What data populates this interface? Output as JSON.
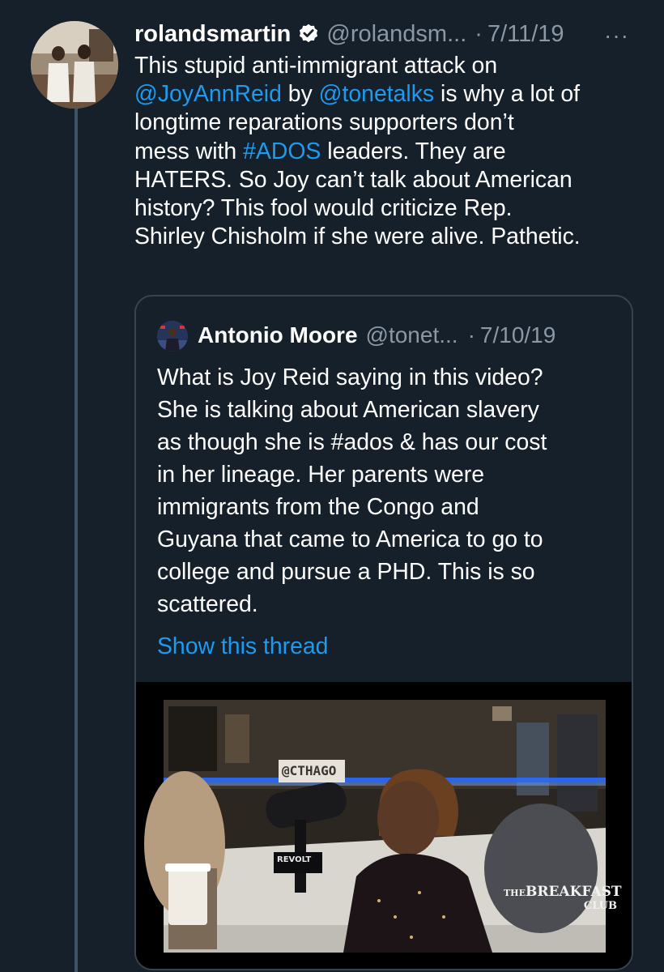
{
  "tweet": {
    "display_name": "rolandsmartin",
    "handle": "@rolandsm...",
    "separator": "·",
    "date": "7/11/19",
    "more_label": "···",
    "verified_icon": "verified-badge-icon",
    "text": {
      "line1": "This stupid anti-immigrant attack on",
      "mention1": "@JoyAnnReid",
      "by": " by ",
      "mention2": "@tonetalks",
      "after_mention2": " is why a lot of",
      "line3": "longtime reparations supporters don’t",
      "line4a": "mess with ",
      "hashtag": "#ADOS",
      "line4b": " leaders. They are",
      "line5": "HATERS. So Joy can’t talk about American",
      "line6": "history? This fool would criticize Rep.",
      "line7": "Shirley Chisholm if she were alive. Pathetic."
    }
  },
  "quoted_tweet": {
    "display_name": "Antonio Moore",
    "handle": "@tonet...",
    "separator": "·",
    "date": "7/10/19",
    "lines": [
      "What is Joy Reid saying in this video?",
      "She is talking about American slavery",
      "as though she is #ados & has our cost",
      "in her lineage. Her parents were",
      "immigrants from the Congo and",
      "Guyana that came to America to go to",
      "college and pursue a PHD. This is so",
      "scattered."
    ],
    "show_thread_label": "Show this thread",
    "video": {
      "overlay_tag": "@CTHAGO",
      "watermark_line1": "THE",
      "watermark_line2": "BREAKFAST",
      "watermark_line3": "CLUB",
      "mic_label": "REVOLT",
      "colors": {
        "blue_light": "#2a6bff",
        "skin": "#5a3a26",
        "hair": "#6b4020"
      }
    }
  },
  "colors": {
    "background": "#15202b",
    "link": "#1d9bf0",
    "muted": "#8b98a5",
    "border": "#38444d",
    "thread_line": "#3d5466"
  }
}
